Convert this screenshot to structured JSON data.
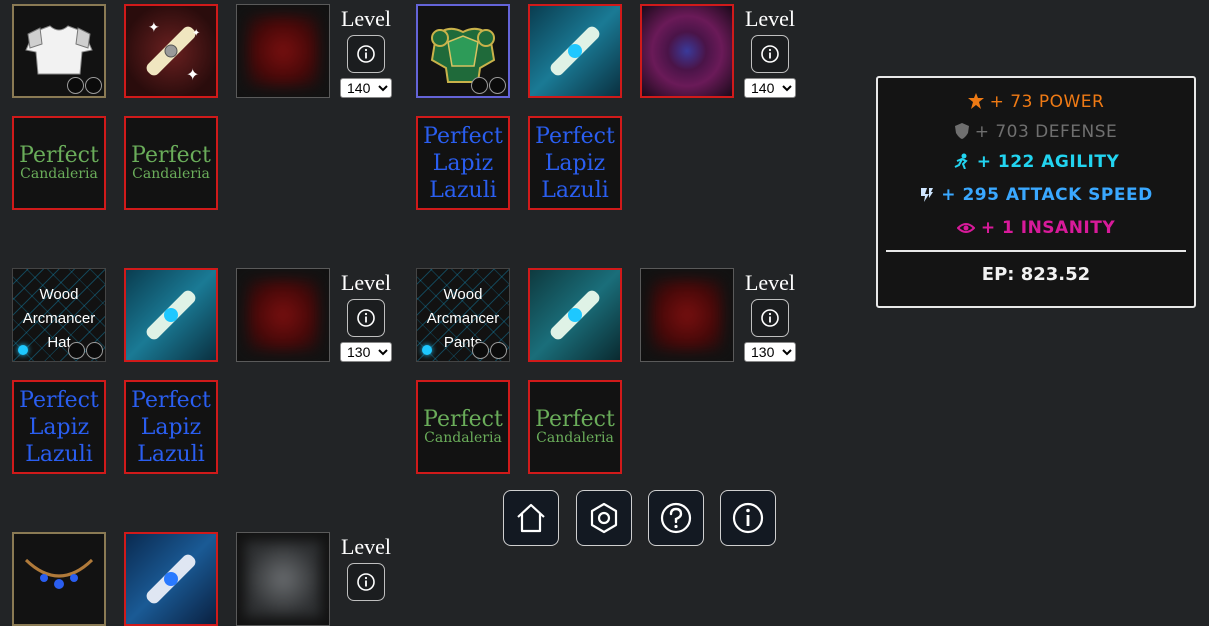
{
  "level_label": "Level",
  "builds": [
    {
      "item_name": "",
      "level": "140",
      "level_options": [
        "140"
      ],
      "gems": [
        {
          "line1": "Perfect",
          "line2": "Candaleria",
          "color": "#6aad5a"
        },
        {
          "line1": "Perfect",
          "line2": "Candaleria",
          "color": "#6aad5a"
        }
      ]
    },
    {
      "item_name": "",
      "level": "140",
      "level_options": [
        "140"
      ],
      "gems": [
        {
          "line1": "Perfect",
          "line2": "Lapiz",
          "line3": "Lazuli",
          "color": "#2a5ef0"
        },
        {
          "line1": "Perfect",
          "line2": "Lapiz",
          "line3": "Lazuli",
          "color": "#2a5ef0"
        }
      ]
    },
    {
      "item_name": "Wood Arcmancer Hat",
      "item_lines": [
        "Wood",
        "Arcmancer",
        "Hat"
      ],
      "level": "130",
      "level_options": [
        "130"
      ],
      "gems": [
        {
          "line1": "Perfect",
          "line2": "Lapiz",
          "line3": "Lazuli",
          "color": "#2a5ef0"
        },
        {
          "line1": "Perfect",
          "line2": "Lapiz",
          "line3": "Lazuli",
          "color": "#2a5ef0"
        }
      ]
    },
    {
      "item_name": "Wood Arcmancer Pants",
      "item_lines": [
        "Wood",
        "Arcmancer",
        "Pants"
      ],
      "level": "130",
      "level_options": [
        "130"
      ],
      "gems": [
        {
          "line1": "Perfect",
          "line2": "Candaleria",
          "color": "#6aad5a"
        },
        {
          "line1": "Perfect",
          "line2": "Candaleria",
          "color": "#6aad5a"
        }
      ]
    },
    {
      "item_name": "",
      "level": "",
      "level_options": []
    }
  ],
  "nav": [
    {
      "name": "home",
      "icon": "home-icon"
    },
    {
      "name": "settings",
      "icon": "hexagon-gear-icon"
    },
    {
      "name": "help",
      "icon": "question-icon"
    },
    {
      "name": "info",
      "icon": "info-icon"
    }
  ],
  "stats": {
    "power": {
      "text": "+ 73 POWER",
      "color": "#ef7a14"
    },
    "defense": {
      "text": "+ 703 DEFENSE",
      "color": "#6f6f6f"
    },
    "agility": {
      "text": "+ 122 AGILITY",
      "color": "#22d4f0"
    },
    "attack_speed": {
      "text": "+ 295 ATTACK SPEED",
      "color": "#3aa8ff"
    },
    "insanity": {
      "text": "+ 1 INSANITY",
      "color": "#d81a9a"
    },
    "ep": "EP: 823.52"
  }
}
